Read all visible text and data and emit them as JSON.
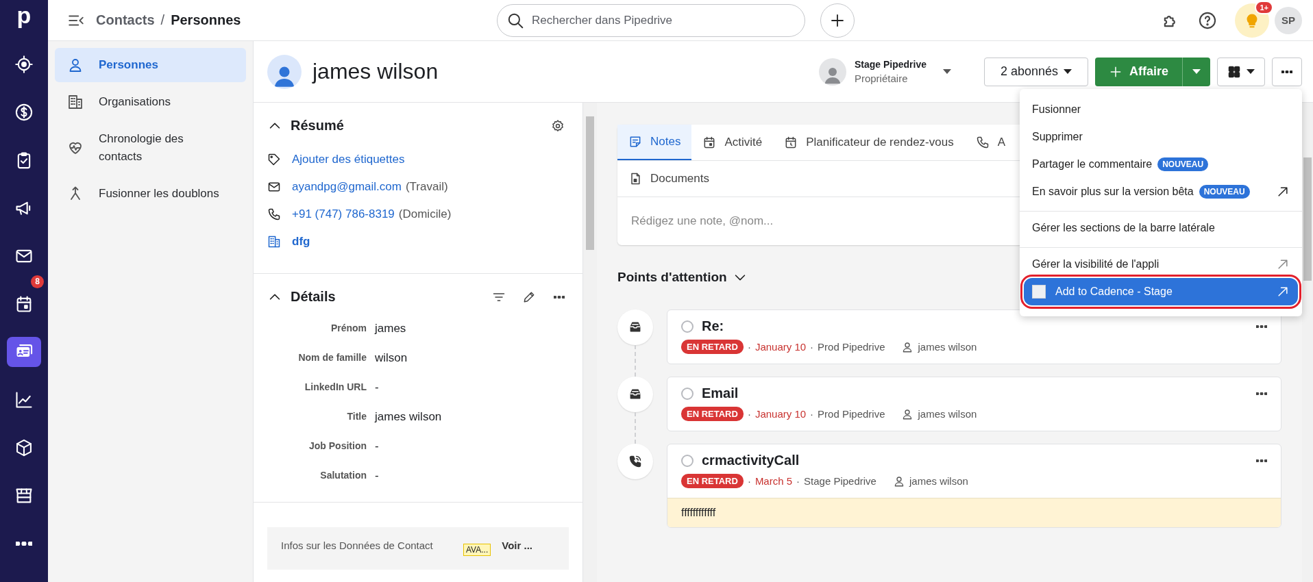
{
  "nav_rail": {
    "logo": "p",
    "items": [
      {
        "selected": false
      },
      {
        "selected": false
      },
      {
        "selected": false
      },
      {
        "selected": false
      },
      {
        "selected": false
      },
      {
        "selected": false,
        "badge": "8"
      },
      {
        "selected": true
      },
      {
        "selected": false
      },
      {
        "selected": false
      },
      {
        "selected": false
      },
      {
        "selected": false
      }
    ]
  },
  "top_bar": {
    "breadcrumb": [
      "Contacts",
      "Personnes"
    ],
    "separator": "/",
    "search": {
      "placeholder": "Rechercher dans Pipedrive"
    },
    "notification_badge": "1+",
    "avatar_initials": "SP"
  },
  "sidebar": {
    "items": [
      {
        "label": "Personnes",
        "selected": true
      },
      {
        "label": "Organisations",
        "selected": false
      },
      {
        "label": "Chronologie des contacts",
        "selected": false
      },
      {
        "label": "Fusionner les doublons",
        "selected": false
      }
    ]
  },
  "person": {
    "name": "james wilson",
    "owner": {
      "name": "Stage Pipedrive",
      "role": "Propriétaire"
    },
    "followers_button": "2 abonnés",
    "add_deal_button": "Affaire"
  },
  "summary": {
    "title": "Résumé",
    "rows": [
      {
        "kind": "tag",
        "text": "Ajouter des étiquettes"
      },
      {
        "kind": "email",
        "text": "ayandpg@gmail.com",
        "note": "(Travail)"
      },
      {
        "kind": "phone",
        "text": "+91 (747) 786-8319",
        "note": "(Domicile)"
      },
      {
        "kind": "organization",
        "text": "dfg"
      }
    ]
  },
  "details": {
    "title": "Détails",
    "fields": [
      {
        "label": "Prénom",
        "value": "james"
      },
      {
        "label": "Nom de famille",
        "value": "wilson"
      },
      {
        "label": "LinkedIn URL",
        "value": "-"
      },
      {
        "label": "Title",
        "value": "james wilson"
      },
      {
        "label": "Job Position",
        "value": "-"
      },
      {
        "label": "Salutation",
        "value": "-"
      }
    ]
  },
  "contact_data": {
    "title": "Infos sur les Données de Contact",
    "badge": "AVA...",
    "link": "Voir ..."
  },
  "tab_rows": [
    [
      {
        "kind": "note",
        "label": "Notes",
        "selected": true
      },
      {
        "kind": "activity",
        "label": "Activité",
        "selected": false
      },
      {
        "kind": "scheduler",
        "label": "Planificateur de rendez-vous",
        "selected": false
      },
      {
        "kind": "call",
        "label": "A",
        "selected": false
      }
    ],
    [
      {
        "kind": "document",
        "label": "Documents",
        "selected": false
      }
    ]
  ],
  "note_field": {
    "placeholder": "Rédigez une note, @nom..."
  },
  "focus": {
    "title": "Points d'attention",
    "separator": "·",
    "activities": [
      {
        "kind": "email",
        "title": "Re:",
        "checked": false,
        "status": "EN RETARD",
        "date": "January 10",
        "owner": "Prod Pipedrive",
        "person": "james wilson"
      },
      {
        "kind": "email",
        "title": "Email",
        "checked": false,
        "status": "EN RETARD",
        "date": "January 10",
        "owner": "Prod Pipedrive",
        "person": "james wilson"
      },
      {
        "kind": "call",
        "title": "crmactivityCall",
        "checked": false,
        "status": "EN RETARD",
        "date": "March 5",
        "owner": "Stage Pipedrive",
        "person": "james wilson",
        "note": "ffffffffffff"
      }
    ]
  },
  "menu": {
    "sections": [
      [
        {
          "kind": "action",
          "label": "Fusionner",
          "external": false,
          "highlighted": false,
          "circled": false
        },
        {
          "kind": "action",
          "label": "Supprimer",
          "external": false,
          "highlighted": false,
          "circled": false
        },
        {
          "kind": "action",
          "label": "Partager le commentaire",
          "badge": "NOUVEAU",
          "external": false,
          "highlighted": false,
          "circled": false
        },
        {
          "kind": "action",
          "label": "En savoir plus sur la version bêta",
          "badge": "NOUVEAU",
          "external": true,
          "highlighted": false,
          "circled": false
        }
      ],
      [
        {
          "kind": "action",
          "label": "Gérer les sections de la barre latérale",
          "external": false,
          "highlighted": false,
          "circled": false
        }
      ],
      [
        {
          "kind": "action",
          "label": "Gérer la visibilité de l'appli",
          "external": true,
          "highlighted": false,
          "circled": false
        },
        {
          "kind": "app",
          "label": "Add to Cadence - Stage",
          "external": true,
          "highlighted": true,
          "circled": true
        }
      ]
    ]
  }
}
